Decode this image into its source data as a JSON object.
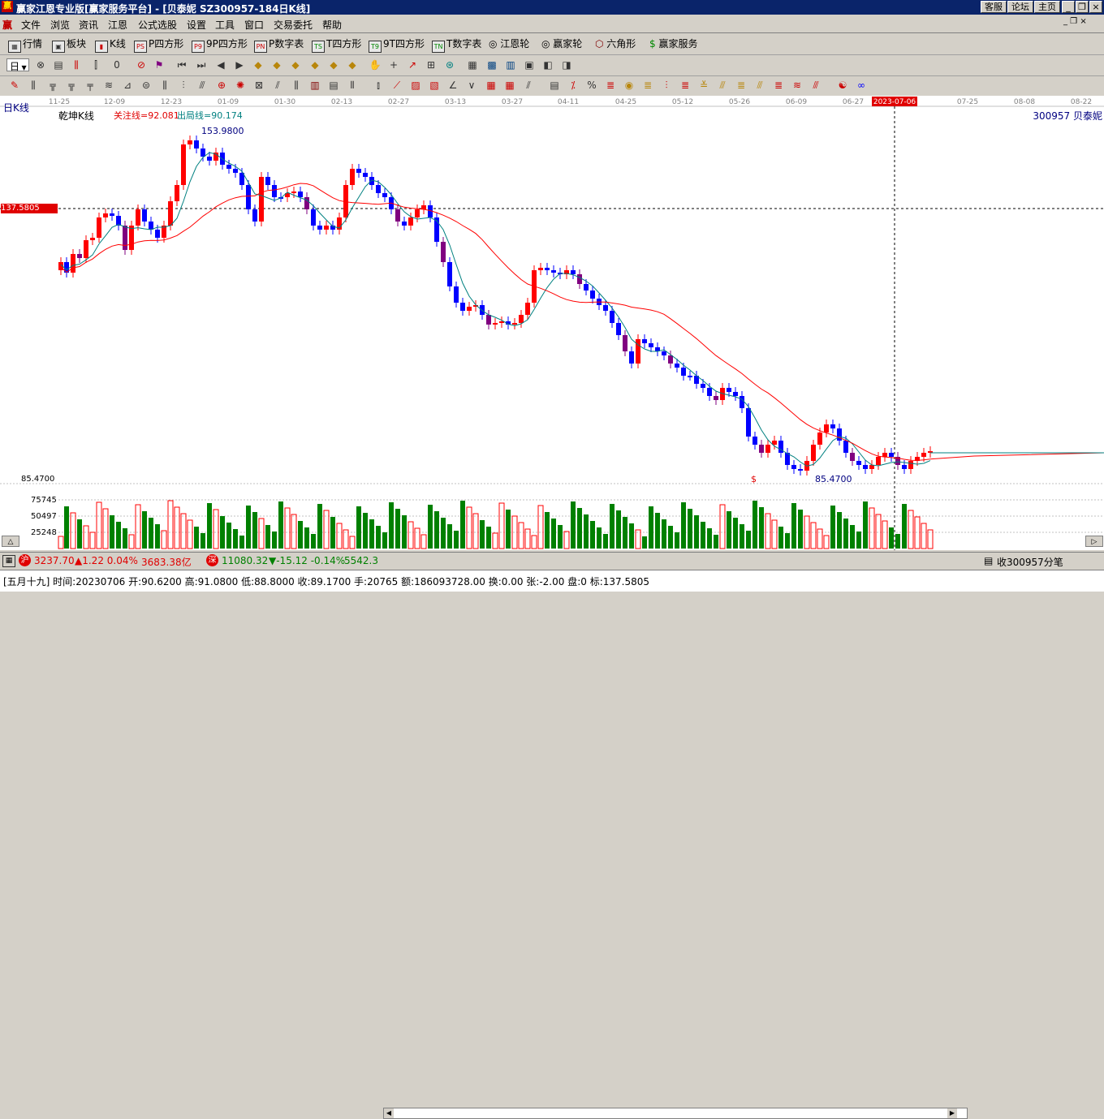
{
  "window": {
    "title": "赢家江恩专业版[赢家服务平台] - [贝泰妮  SZ300957-184日K线]",
    "logo": "赢",
    "top_buttons": [
      "客服",
      "论坛",
      "主页"
    ]
  },
  "menu": {
    "logo": "赢",
    "items": [
      "文件",
      "浏览",
      "资讯",
      "江恩",
      "公式选股",
      "设置",
      "工具",
      "窗口",
      "交易委托",
      "帮助"
    ]
  },
  "toolbar1": {
    "items": [
      {
        "label": "行情",
        "icon": "grid-icon"
      },
      {
        "label": "板块",
        "icon": "blocks-icon"
      },
      {
        "label": "K线",
        "icon": "candle-icon"
      },
      {
        "label": "P四方形",
        "icon": "P"
      },
      {
        "label": "9P四方形",
        "icon": "9P"
      },
      {
        "label": "P数字表",
        "icon": "PN"
      },
      {
        "label": "T四方形",
        "icon": "TS"
      },
      {
        "label": "9T四方形",
        "icon": "T9"
      },
      {
        "label": "T数字表",
        "icon": "TN"
      },
      {
        "label": "江恩轮",
        "icon": "wheel-icon"
      },
      {
        "label": "赢家轮",
        "icon": "wheel-icon"
      },
      {
        "label": "六角形",
        "icon": "hexagon-icon"
      },
      {
        "label": "赢家服务",
        "icon": "dollar-icon"
      }
    ]
  },
  "toolbar2": {
    "period": "日"
  },
  "chart": {
    "period_label": "日K线",
    "indicator_name": "乾坤K线",
    "guanzhu_line": "关注线=92.081",
    "chuju_line": "出局线=90.174",
    "stock_code_name": "300957  贝泰妮",
    "date_ticks": [
      "11-25",
      "12-09",
      "12-23",
      "01-09",
      "01-30",
      "02-13",
      "02-27",
      "03-13",
      "03-27",
      "04-11",
      "04-25",
      "05-12",
      "05-26",
      "06-09",
      "06-27",
      "2023-07-06",
      "07-25",
      "08-08",
      "08-22"
    ],
    "crosshair_price": "137.5805",
    "high_label": "153.9800",
    "low_label": "85.4700",
    "y_bottom_label": "85.4700",
    "volume_ticks": [
      "75745",
      "50497",
      "25248"
    ],
    "dollar_marker": "$"
  },
  "chart_data": {
    "type": "candlestick",
    "price_range": [
      85.47,
      153.98
    ],
    "crosshair_value": 137.5805,
    "crosshair_date": "2023-07-06",
    "high": 153.98,
    "low": 85.47
  },
  "statusbar": {
    "sh_badge": "沪",
    "sh_index": "3237.70",
    "sh_change": "▲1.22 0.04%",
    "sh_amount": "3683.38亿",
    "sz_badge": "深",
    "sz_index": "11080.32",
    "sz_change": "▼-15.12 -0.14%",
    "sz_amount": "5542.3",
    "right_text": "收300957分笔"
  },
  "infobar": {
    "text": "[五月十九] 时间:20230706 开:90.6200 高:91.0800 低:88.8000 收:89.1700 手:20765 额:186093728.00 换:0.00 张:-2.00 盘:0 标:137.5805"
  }
}
